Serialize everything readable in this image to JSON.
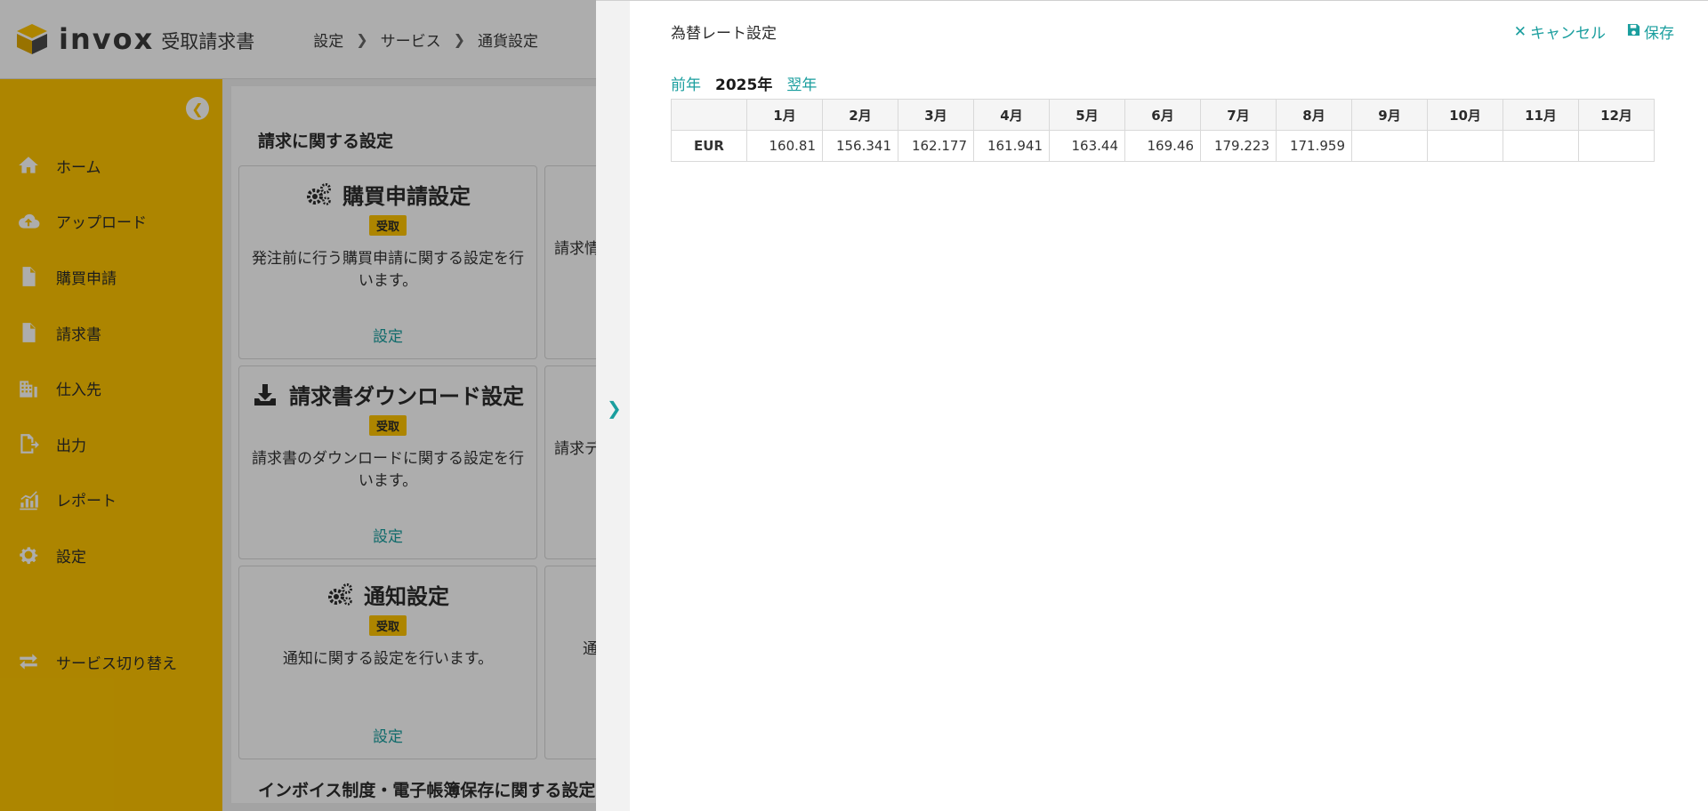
{
  "header": {
    "brand": "invox",
    "product": "受取請求書",
    "breadcrumb": [
      "設定",
      "サービス",
      "通貨設定"
    ]
  },
  "sidebar": {
    "items": [
      {
        "label": "ホーム",
        "icon": "home-icon"
      },
      {
        "label": "アップロード",
        "icon": "cloud-upload-icon"
      },
      {
        "label": "購買申請",
        "icon": "document-icon"
      },
      {
        "label": "請求書",
        "icon": "document-icon"
      },
      {
        "label": "仕入先",
        "icon": "building-icon"
      },
      {
        "label": "出力",
        "icon": "export-icon"
      },
      {
        "label": "レポート",
        "icon": "chart-icon"
      },
      {
        "label": "設定",
        "icon": "gear-icon"
      }
    ],
    "switch_label": "サービス切り替え"
  },
  "main": {
    "section_title": "請求に関する設定",
    "section_title_bottom": "インボイス制度・電子帳簿保存に関する設定",
    "cards": [
      {
        "title": "購買申請設定",
        "badge": "受取",
        "desc": "発注前に行う購買申請に関する設定を行います。",
        "link": "設定"
      },
      {
        "title": "請求書ダウンロード設定",
        "badge": "受取",
        "desc": "請求書のダウンロードに関する設定を行います。",
        "link": "設定"
      },
      {
        "title": "通知設定",
        "badge": "受取",
        "desc": "通知に関する設定を行います。",
        "link": "設定"
      }
    ],
    "right_cards": [
      {
        "desc": "請求情"
      },
      {
        "desc": "請求デ"
      },
      {
        "desc": "通"
      }
    ]
  },
  "drawer": {
    "title": "為替レート設定",
    "cancel_label": "キャンセル",
    "save_label": "保存",
    "prev_year": "前年",
    "current_year": "2025年",
    "next_year": "翌年",
    "table": {
      "months": [
        "1月",
        "2月",
        "3月",
        "4月",
        "5月",
        "6月",
        "7月",
        "8月",
        "9月",
        "10月",
        "11月",
        "12月"
      ],
      "rows": [
        {
          "currency": "EUR",
          "values": [
            "160.81",
            "156.341",
            "162.177",
            "161.941",
            "163.44",
            "169.46",
            "179.223",
            "171.959",
            "",
            "",
            "",
            ""
          ]
        }
      ]
    }
  },
  "colors": {
    "accent": "#ffc500",
    "link": "#1a9e9e"
  }
}
